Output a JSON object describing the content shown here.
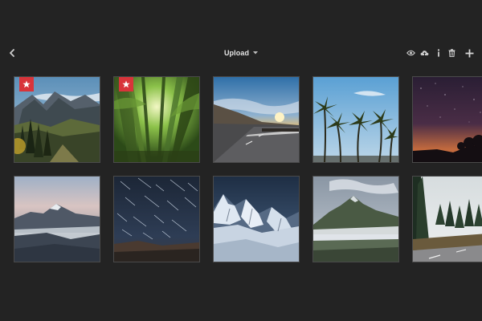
{
  "toolbar": {
    "title": "Upload",
    "icons": {
      "back": "chevron-left-icon",
      "title_menu": "caret-down-icon",
      "preview": "eye-icon",
      "cloud_upload": "cloud-upload-icon",
      "info": "info-icon",
      "delete": "trash-icon",
      "add": "plus-icon"
    }
  },
  "colors": {
    "background": "#232323",
    "favorite_badge": "#d8343a",
    "text": "#e6e6e6",
    "icon": "#cfcfcf"
  },
  "photos": [
    {
      "subject": "mountain-valley",
      "favorite": true
    },
    {
      "subject": "bamboo-forest",
      "favorite": true
    },
    {
      "subject": "sunset-road",
      "favorite": false
    },
    {
      "subject": "palm-trees",
      "favorite": false
    },
    {
      "subject": "night-sky-dusk",
      "favorite": false
    },
    {
      "subject": "misty-mountain",
      "favorite": false
    },
    {
      "subject": "star-trails",
      "favorite": false
    },
    {
      "subject": "snowy-peaks",
      "favorite": false
    },
    {
      "subject": "fog-lake-mountain",
      "favorite": false
    },
    {
      "subject": "pine-forest-road",
      "favorite": false
    }
  ]
}
